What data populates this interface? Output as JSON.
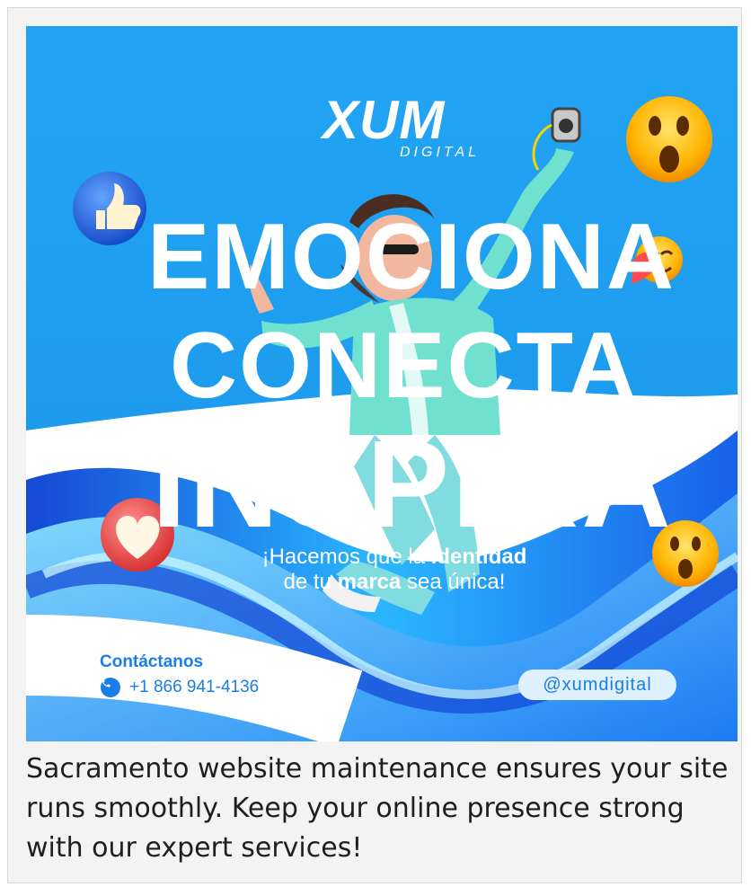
{
  "brand": {
    "logo_main": "XUM",
    "logo_sub": "DIGITAL"
  },
  "headline": {
    "line1": "EMOCIONA",
    "line2": "CONECTA",
    "line3": "INSPIRA"
  },
  "slogan": {
    "part1": "¡Hacemos que la",
    "bold1": "identidad",
    "part2": "de tu",
    "bold2": "marca",
    "part3": "sea única!"
  },
  "contact": {
    "title": "Contáctanos",
    "phone": "+1 866 941-4136"
  },
  "social": {
    "handle": "@xumdigital"
  },
  "caption": {
    "line1": "Sacramento website maintenance ensures your site",
    "line2": "runs smoothly. Keep your online presence strong",
    "line3": "with our expert services!"
  },
  "icons": [
    "like-icon",
    "heart-icon",
    "surprised-emoji-icon",
    "hug-emoji-icon",
    "phone-icon"
  ],
  "colors": {
    "poster_blue": "#1f9ff1",
    "contact_blue": "#1a7ee7",
    "pill_bg": "#dff1ff"
  }
}
